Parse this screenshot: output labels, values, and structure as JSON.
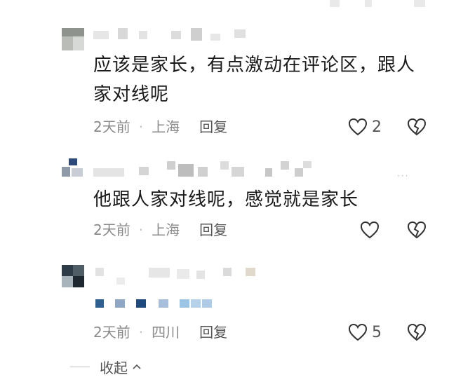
{
  "comments": [
    {
      "text": "应该是家长，有点激动在评论区，跟人家对线呢",
      "time": "2天前",
      "location": "上海",
      "reply": "回复",
      "likes": "2"
    },
    {
      "text": "他跟人家对线呢，感觉就是家长",
      "time": "2天前",
      "location": "上海",
      "reply": "回复",
      "likes": ""
    },
    {
      "text": "",
      "time": "2天前",
      "location": "四川",
      "reply": "回复",
      "likes": "5"
    }
  ],
  "collapse_label": "收起",
  "icons": {
    "like": "heart-icon",
    "dislike": "broken-heart-icon",
    "collapse": "chevron-up-icon"
  }
}
